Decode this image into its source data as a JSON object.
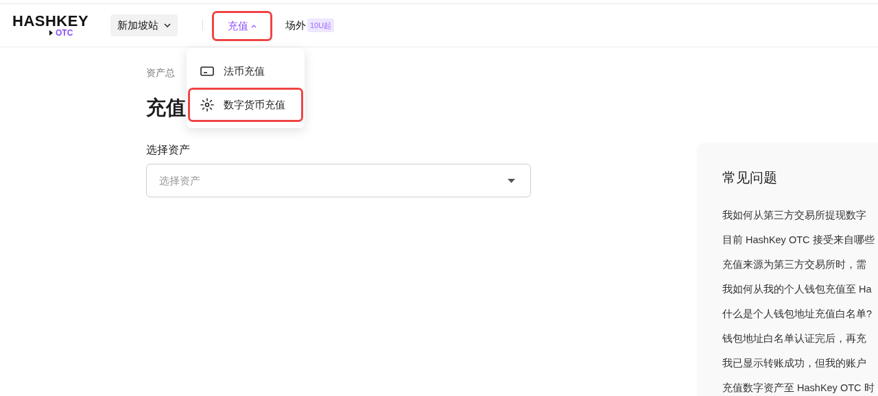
{
  "header": {
    "logo": {
      "name": "HASHKEY",
      "sub": "OTC"
    },
    "region": {
      "label": "新加坡站"
    },
    "nav": [
      {
        "label": "充值",
        "selected": true,
        "dropdown": true,
        "highlighted": true
      },
      {
        "label": "场外",
        "selected": false,
        "dropdown": false,
        "highlighted": false,
        "badge": "10U起"
      }
    ]
  },
  "menu": {
    "open": true,
    "items": [
      {
        "label": "法币充值",
        "kind": "card",
        "highlighted": false
      },
      {
        "label": "数字货币充值",
        "kind": "crypto",
        "highlighted": true
      }
    ]
  },
  "breadcrumb": "资产总",
  "title": "充值",
  "asset_select": {
    "label": "选择资产",
    "placeholder": "选择资产"
  },
  "faq": {
    "title": "常见问题",
    "items": [
      "我如何从第三方交易所提现数字",
      "目前 HashKey OTC 接受来自哪些",
      "充值来源为第三方交易所时，需",
      "我如何从我的个人钱包充值至 Ha",
      "什么是个人钱包地址充值白名单?",
      "钱包地址白名单认证完后，再充",
      "我已显示转账成功，但我的账户",
      "充值数字资产至 HashKey OTC 时"
    ]
  }
}
